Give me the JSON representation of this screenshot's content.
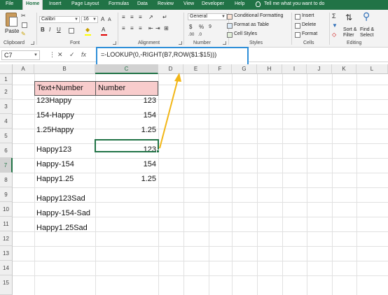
{
  "ribbon_tabs": [
    "File",
    "Home",
    "Insert",
    "Page Layout",
    "Formulas",
    "Data",
    "Review",
    "View",
    "Developer",
    "Help",
    "Tell me what you want to do"
  ],
  "active_tab": "Home",
  "clipboard": {
    "paste_label": "Paste",
    "group_label": "Clipboard"
  },
  "font": {
    "name": "Calibri",
    "size": "16",
    "group_label": "Font"
  },
  "alignment": {
    "group_label": "Alignment"
  },
  "number": {
    "format": "General",
    "currency": "$",
    "percent": "%",
    "group_label": "Number"
  },
  "styles": {
    "conditional_formatting": "Conditional Formatting",
    "format_as_table": "Format as Table",
    "cell_styles": "Cell Styles",
    "group_label": "Styles"
  },
  "cells": {
    "insert": "Insert",
    "delete": "Delete",
    "format": "Format",
    "group_label": "Cells"
  },
  "editing": {
    "sort_filter_1": "Sort &",
    "sort_filter_2": "Filter",
    "find_select_1": "Find &",
    "find_select_2": "Select",
    "group_label": "Editing"
  },
  "formula_bar": {
    "name_box": "C7",
    "fx": "fx",
    "formula": "=-LOOKUP(0,-RIGHT(B7,ROW($1:$15)))"
  },
  "columns": [
    "A",
    "B",
    "C",
    "D",
    "E",
    "F",
    "G",
    "H",
    "I",
    "J",
    "K",
    "L"
  ],
  "rows": [
    "1",
    "2",
    "3",
    "4",
    "5",
    "6",
    "7",
    "8",
    "9",
    "10",
    "11",
    "12",
    "13",
    "14",
    "15"
  ],
  "sheet": {
    "header_b": "Text+Number",
    "header_c": "Number",
    "b3": "123Happy",
    "c3": "123",
    "b4": "154-Happy",
    "c4": "154",
    "b5": "1.25Happy",
    "c5": "1.25",
    "b7": "Happy123",
    "c7": "123",
    "b8": "Happy-154",
    "c8": "154",
    "b9": "Happy1.25",
    "c9": "1.25",
    "b11": "Happy123Sad",
    "b12": "Happy-154-Sad",
    "b13": "Happy1.25Sad"
  },
  "colors": {
    "excel_green": "#217346",
    "header_fill": "#f8cccc",
    "highlight_box": "#2f8fd8",
    "arrow": "#f2b616"
  }
}
